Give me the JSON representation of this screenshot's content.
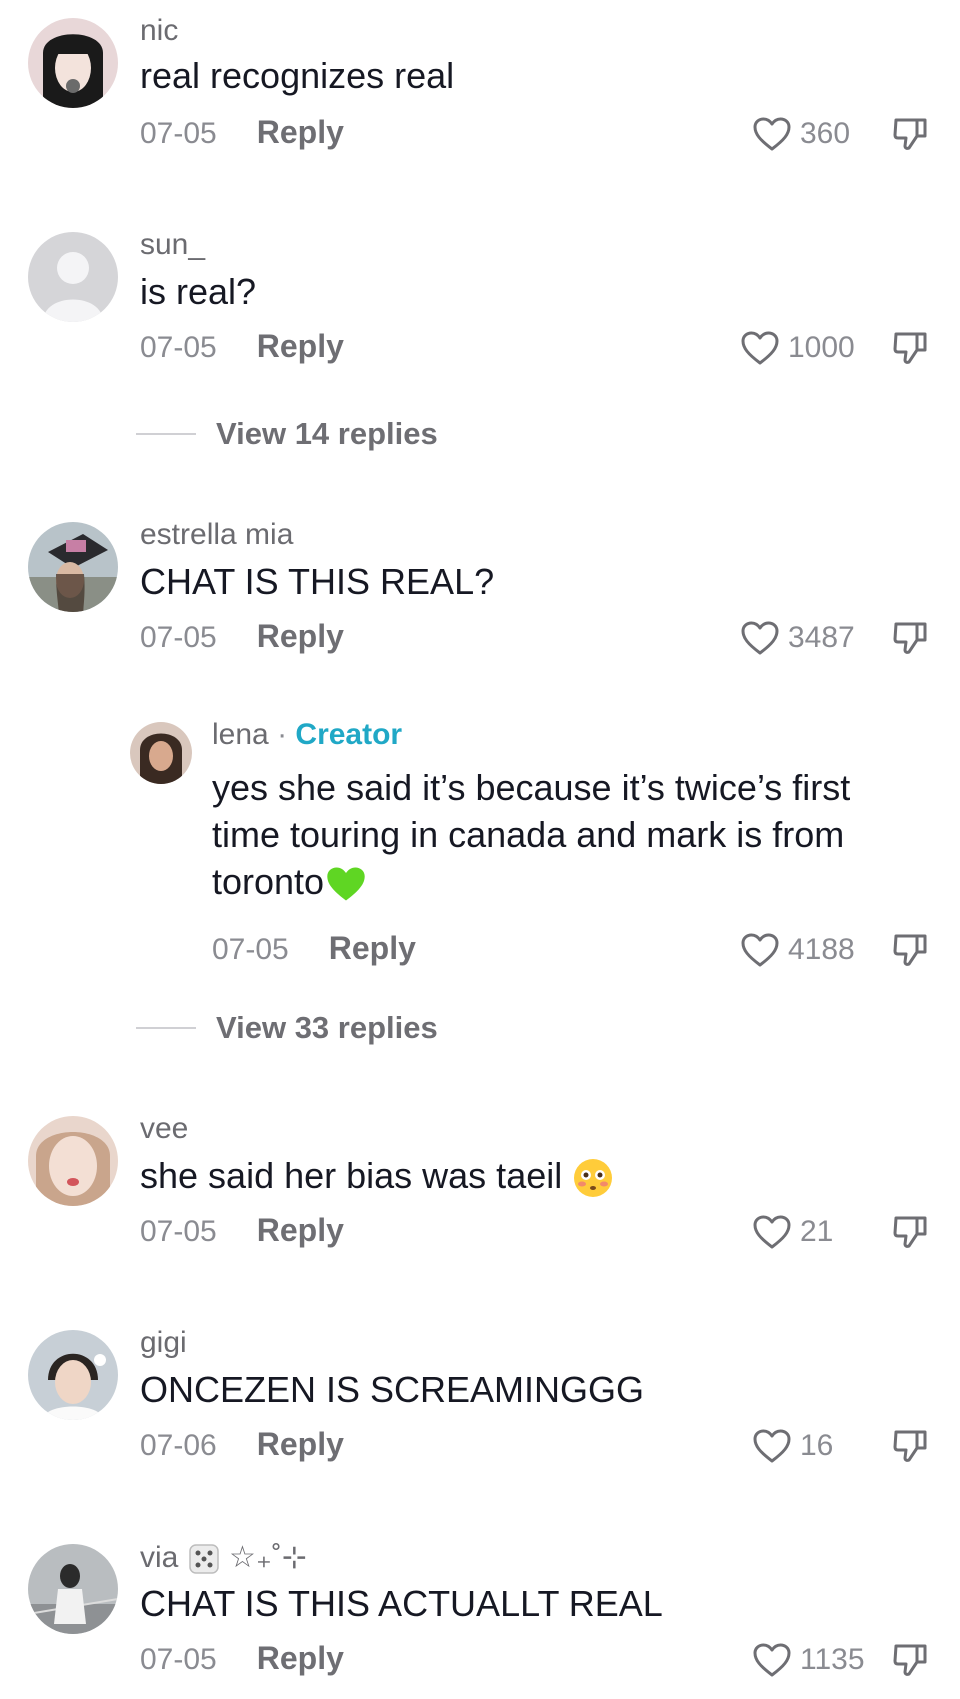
{
  "comments": [
    {
      "user": "nic",
      "text": "real recognizes real",
      "date": "07-05",
      "reply": "Reply",
      "likes": "360"
    },
    {
      "user": "sun_",
      "text": "is real?",
      "date": "07-05",
      "reply": "Reply",
      "likes": "1000",
      "view_replies": "View 14 replies"
    },
    {
      "user": "estrella mia",
      "text": "CHAT IS THIS REAL?",
      "date": "07-05",
      "reply": "Reply",
      "likes": "3487",
      "view_replies": "View 33 replies",
      "creator_reply": {
        "user": "lena",
        "separator": "·",
        "badge": "Creator",
        "line1": "yes she said it’s because it’s twice’s first",
        "line2": "time touring in canada and mark is from",
        "line3": "toronto",
        "date": "07-05",
        "reply": "Reply",
        "likes": "4188"
      }
    },
    {
      "user": "vee",
      "text": "she said her bias was taeil",
      "date": "07-05",
      "reply": "Reply",
      "likes": "21"
    },
    {
      "user": "gigi",
      "text": "ONCEZEN IS SCREAMINGGG",
      "date": "07-06",
      "reply": "Reply",
      "likes": "16"
    },
    {
      "user": "via",
      "user_deco": "☆₊˚⊹",
      "text": "CHAT IS THIS ACTUALLT REAL",
      "date": "07-05",
      "reply": "Reply",
      "likes": "1135"
    }
  ],
  "icons": {
    "like": "heart-outline-icon",
    "dislike": "thumbs-down-icon"
  },
  "colors": {
    "creator": "#20a8c6",
    "text": "#161823",
    "muted": "#8a8b91"
  }
}
